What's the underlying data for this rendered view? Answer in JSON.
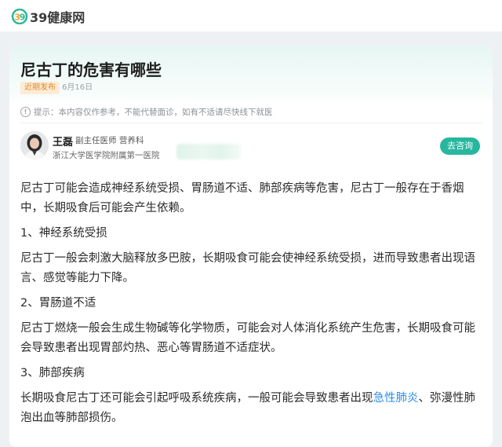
{
  "site": {
    "logo_text": "39健康网"
  },
  "article": {
    "title": "尼古丁的危害有哪些",
    "badge": "近期发布",
    "date": "6月16日",
    "notice": "提示：本内容仅作参考，不能代替面诊，如有不适请尽快线下就医"
  },
  "doctor": {
    "name": "王磊",
    "title": "副主任医师 营养科",
    "hospital": "浙江大学医学院附属第一医院",
    "consult_label": "去咨询"
  },
  "content": {
    "intro": "尼古丁可能会造成神经系统受损、胃肠道不适、肺部疾病等危害，尼古丁一般存在于香烟中，长期吸食后可能会产生依赖。",
    "sections": [
      {
        "heading": "1、神经系统受损",
        "text": "尼古丁一般会刺激大脑释放多巴胺，长期吸食可能会使神经系统受损，进而导致患者出现语言、感觉等能力下降。"
      },
      {
        "heading": "2、胃肠道不适",
        "text": "尼古丁燃烧一般会生成生物碱等化学物质，可能会对人体消化系统产生危害，长期吸食可能会导致患者出现胃部灼热、恶心等胃肠道不适症状。"
      },
      {
        "heading": "3、肺部疾病",
        "text_before": "长期吸食尼古丁还可能会引起呼吸系统疾病，一般可能会导致患者出现",
        "link": "急性肺炎",
        "text_after": "、弥漫性肺泡出血等肺部损伤。"
      }
    ]
  },
  "colors": {
    "accent": "#27b79f",
    "link": "#2a8df0",
    "badge_text": "#e58a2a",
    "badge_bg": "#fdecd6"
  }
}
